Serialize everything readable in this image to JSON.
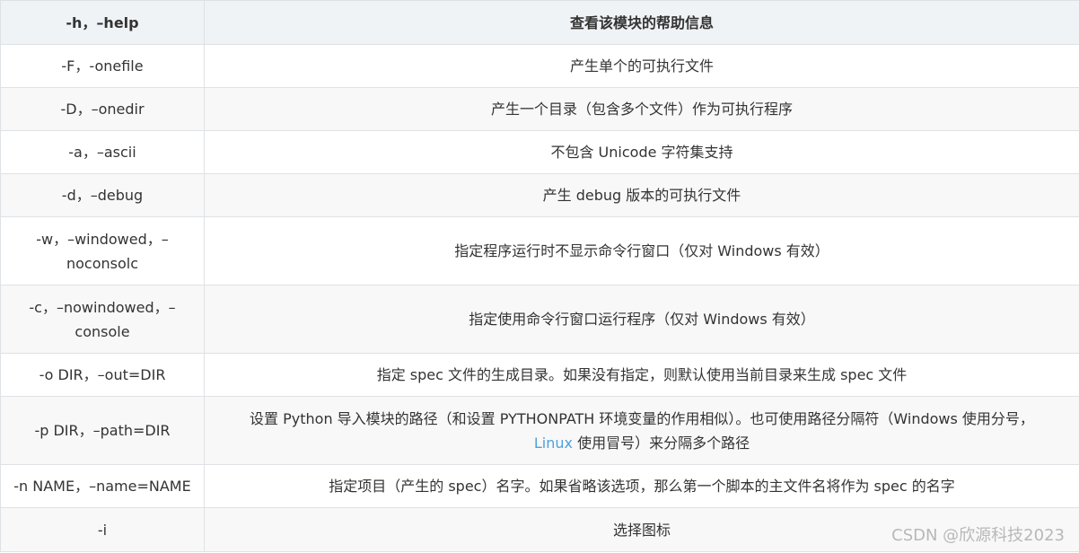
{
  "table": {
    "header": [
      "-h，–help",
      "查看该模块的帮助信息"
    ],
    "rows": [
      {
        "option": "-F，-onefile",
        "desc": "产生单个的可执行文件"
      },
      {
        "option": "-D，–onedir",
        "desc": "产生一个目录（包含多个文件）作为可执行程序"
      },
      {
        "option": "-a，–ascii",
        "desc": "不包含 Unicode 字符集支持"
      },
      {
        "option": "-d，–debug",
        "desc": "产生 debug 版本的可执行文件"
      },
      {
        "option_line1": "-w，–windowed，–",
        "option_line2": "noconsolc",
        "desc": "指定程序运行时不显示命令行窗口（仅对 Windows 有效）"
      },
      {
        "option_line1": "-c，–nowindowed，–",
        "option_line2": "console",
        "desc": "指定使用命令行窗口运行程序（仅对 Windows 有效）"
      },
      {
        "option": "-o DIR，–out=DIR",
        "desc": "指定 spec 文件的生成目录。如果没有指定，则默认使用当前目录来生成 spec 文件"
      },
      {
        "option": "-p DIR，–path=DIR",
        "desc_line1": "设置 Python 导入模块的路径（和设置 PYTHONPATH 环境变量的作用相似）。也可使用路径分隔符（Windows 使用分号，",
        "desc_link": "Linux",
        "desc_line2_rest": " 使用冒号）来分隔多个路径"
      },
      {
        "option": "-n NAME，–name=NAME",
        "desc": "指定项目（产生的 spec）名字。如果省略该选项，那么第一个脚本的主文件名将作为 spec 的名字"
      },
      {
        "option": "-i",
        "desc": "选择图标"
      }
    ]
  },
  "watermark": "CSDN @欣源科技2023"
}
